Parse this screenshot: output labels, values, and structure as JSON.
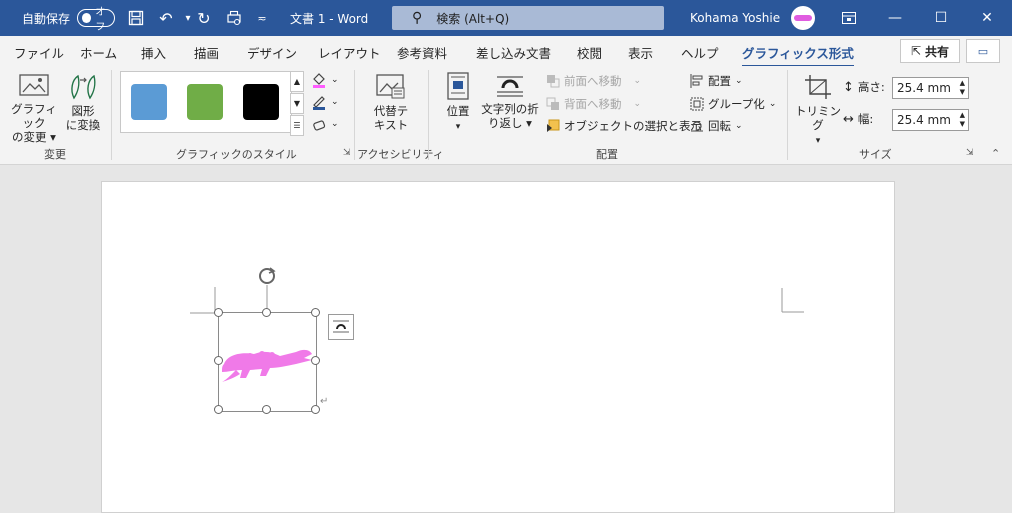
{
  "titlebar": {
    "autosave_label": "自動保存",
    "autosave_state": "オフ",
    "doc_title": "文書 1  -  Word",
    "search_placeholder": "検索 (Alt+Q)",
    "user_name": "Kohama Yoshie",
    "bg_color": "#2b579a"
  },
  "tabs": [
    "ファイル",
    "ホーム",
    "挿入",
    "描画",
    "デザイン",
    "レイアウト",
    "参考資料",
    "差し込み文書",
    "校閲",
    "表示",
    "ヘルプ",
    "グラフィックス形式"
  ],
  "active_tab": "グラフィックス形式",
  "share_label": "共有",
  "ribbon": {
    "change_group": {
      "label": "変更",
      "btn_change_graphic": [
        "グラフィック",
        "の変更 ▾"
      ],
      "btn_convert_shape": [
        "図形",
        "に変換"
      ]
    },
    "styles_group": {
      "label": "グラフィックのスタイル",
      "swatches": [
        "#5b9bd5",
        "#70ad47",
        "#000000"
      ]
    },
    "accessibility_group": {
      "label": "アクセシビリティ",
      "btn_alt_text": [
        "代替テ",
        "キスト"
      ]
    },
    "arrange_group": {
      "label": "配置",
      "btn_position": [
        "位置",
        "▾"
      ],
      "btn_wrap_text": [
        "文字列の折",
        "り返し ▾"
      ],
      "bring_forward": "前面へ移動",
      "send_backward": "背面へ移動",
      "selection_pane": "オブジェクトの選択と表示",
      "align": "配置",
      "group": "グループ化",
      "rotate": "回転"
    },
    "size_group": {
      "label": "サイズ",
      "btn_crop": [
        "トリミング",
        "▾"
      ],
      "height_label": "高さ:",
      "height_value": "25.4 mm",
      "width_label": "幅:",
      "width_value": "25.4 mm"
    }
  },
  "graphic": {
    "fill_color": "#f07ae8",
    "shape": "crocodile-icon"
  }
}
